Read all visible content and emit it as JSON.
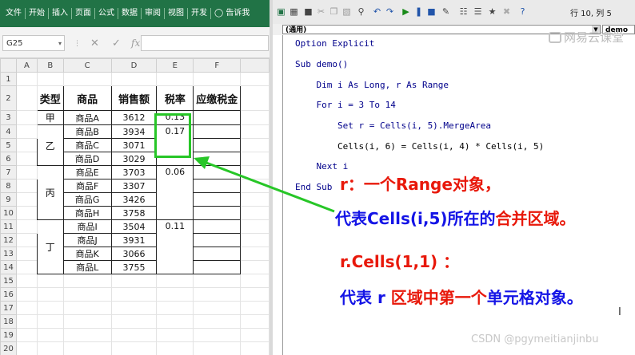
{
  "excel": {
    "ribbon_tabs": [
      "文件",
      "开始",
      "插入",
      "页面",
      "公式",
      "数据",
      "审阅",
      "视图",
      "开发",
      "告诉我"
    ],
    "name_box": "G25",
    "col_headers": [
      "A",
      "B",
      "C",
      "D",
      "E",
      "F"
    ],
    "row_numbers": [
      "1",
      "2",
      "3",
      "4",
      "5",
      "6",
      "7",
      "8",
      "9",
      "10",
      "11",
      "12",
      "13",
      "14",
      "15",
      "16",
      "17",
      "18",
      "19",
      "20"
    ],
    "headers": {
      "type": "类型",
      "product": "商品",
      "sales": "销售额",
      "rate": "税率",
      "tax": "应缴税金"
    },
    "groups": [
      {
        "type": "甲",
        "rate": "0.13",
        "rows": [
          {
            "product": "商品A",
            "sales": "3612"
          }
        ]
      },
      {
        "type": "乙",
        "rate": "0.17",
        "rows": [
          {
            "product": "商品B",
            "sales": "3934"
          },
          {
            "product": "商品C",
            "sales": "3071"
          },
          {
            "product": "商品D",
            "sales": "3029"
          }
        ]
      },
      {
        "type": "丙",
        "rate": "0.06",
        "rows": [
          {
            "product": "商品E",
            "sales": "3703"
          },
          {
            "product": "商品F",
            "sales": "3307"
          },
          {
            "product": "商品G",
            "sales": "3426"
          },
          {
            "product": "商品H",
            "sales": "3758"
          }
        ]
      },
      {
        "type": "丁",
        "rate": "0.11",
        "rows": [
          {
            "product": "商品I",
            "sales": "3504"
          },
          {
            "product": "商品J",
            "sales": "3931"
          },
          {
            "product": "商品K",
            "sales": "3066"
          },
          {
            "product": "商品L",
            "sales": "3755"
          }
        ]
      }
    ]
  },
  "vba": {
    "row_col": "行 10, 列 5",
    "object_combo": "(通用)",
    "proc_combo": "demo",
    "code_lines": [
      "Option Explicit",
      "Sub demo()",
      "    Dim i As Long, r As Range",
      "    For i = 3 To 14",
      "        Set r = Cells(i, 5).MergeArea",
      "        Cells(i, 6) = Cells(i, 4) * Cells(i, 5)",
      "    Next i",
      "End Sub"
    ]
  },
  "annotations": {
    "note1": "r：一个Range对象，",
    "note2_blue": "代表Cells(i,5)所在的",
    "note2_red": "合并区域。",
    "note3": "r.Cells(1,1) ：",
    "note4_a": "代表 r ",
    "note4_b": "区域中第一个",
    "note4_c": "单元格对象。",
    "watermark": "网易云课堂",
    "csdn": "CSDN @pgymeitianjinbu"
  },
  "colors": {
    "excel_green": "#217346",
    "highlight_green": "#27c627",
    "red": "#e8180a",
    "blue": "#1414e6"
  }
}
